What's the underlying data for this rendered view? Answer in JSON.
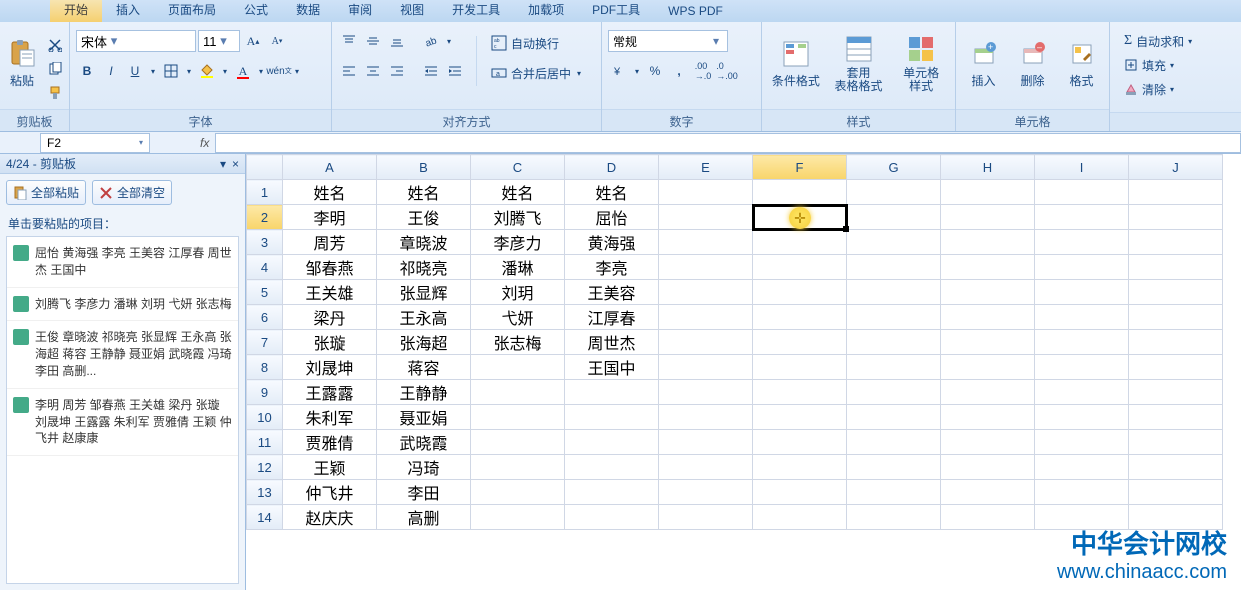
{
  "tabs": [
    "开始",
    "插入",
    "页面布局",
    "公式",
    "数据",
    "审阅",
    "视图",
    "开发工具",
    "加载项",
    "PDF工具",
    "WPS PDF"
  ],
  "active_tab": 0,
  "ribbon": {
    "clipboard": {
      "label": "剪贴板",
      "paste": "粘贴"
    },
    "font": {
      "label": "字体",
      "name": "宋体",
      "size": "11"
    },
    "align": {
      "label": "对齐方式",
      "wrap": "自动换行",
      "merge": "合并后居中"
    },
    "number": {
      "label": "数字",
      "format": "常规"
    },
    "styles": {
      "label": "样式",
      "cond": "条件格式",
      "table": "套用\n表格格式",
      "cell": "单元格\n样式"
    },
    "cells": {
      "label": "单元格",
      "insert": "插入",
      "delete": "删除",
      "format": "格式"
    },
    "editing": {
      "sum": "自动求和",
      "fill": "填充",
      "clear": "清除"
    }
  },
  "name_box": "F2",
  "clipboard_pane": {
    "title": "4/24 - 剪贴板",
    "paste_all": "全部粘贴",
    "clear_all": "全部清空",
    "hint": "单击要粘贴的项目：",
    "items": [
      "屈怡 黄海强 李亮 王美容 江厚春 周世杰 王国中",
      "刘腾飞 李彦力 潘琳 刘玥 弋妍 张志梅",
      "王俊 章晓波 祁晓亮 张显辉 王永高 张海超 蒋容 王静静 聂亚娟 武晓霞 冯琦 李田 高删...",
      "李明 周芳 邹春燕 王关雄 梁丹 张璇 刘晟坤 王露露 朱利军 贾雅倩 王颖 仲飞井 赵康康"
    ]
  },
  "columns": [
    "A",
    "B",
    "C",
    "D",
    "E",
    "F",
    "G",
    "H",
    "I",
    "J"
  ],
  "rows": [
    1,
    2,
    3,
    4,
    5,
    6,
    7,
    8,
    9,
    10,
    11,
    12,
    13,
    14
  ],
  "cells": {
    "A1": "姓名",
    "B1": "姓名",
    "C1": "姓名",
    "D1": "姓名",
    "A2": "李明",
    "B2": "王俊",
    "C2": "刘腾飞",
    "D2": "屈怡",
    "A3": "周芳",
    "B3": "章晓波",
    "C3": "李彦力",
    "D3": "黄海强",
    "A4": "邹春燕",
    "B4": "祁晓亮",
    "C4": "潘琳",
    "D4": "李亮",
    "A5": "王关雄",
    "B5": "张显辉",
    "C5": "刘玥",
    "D5": "王美容",
    "A6": "梁丹",
    "B6": "王永高",
    "C6": "弋妍",
    "D6": "江厚春",
    "A7": "张璇",
    "B7": "张海超",
    "C7": "张志梅",
    "D7": "周世杰",
    "A8": "刘晟坤",
    "B8": "蒋容",
    "C8": "",
    "D8": "王国中",
    "A9": "王露露",
    "B9": "王静静",
    "A10": "朱利军",
    "B10": "聂亚娟",
    "A11": "贾雅倩",
    "B11": "武晓霞",
    "A12": "王颖",
    "B12": "冯琦",
    "A13": "仲飞井",
    "B13": "李田",
    "A14": "赵庆庆",
    "B14": "高删"
  },
  "selected_cell": "F2",
  "marquee_range": {
    "col": "D",
    "r1": 2,
    "r2": 8
  },
  "watermark": {
    "l1": "中华会计网校",
    "l2": "www.chinaacc.com"
  }
}
